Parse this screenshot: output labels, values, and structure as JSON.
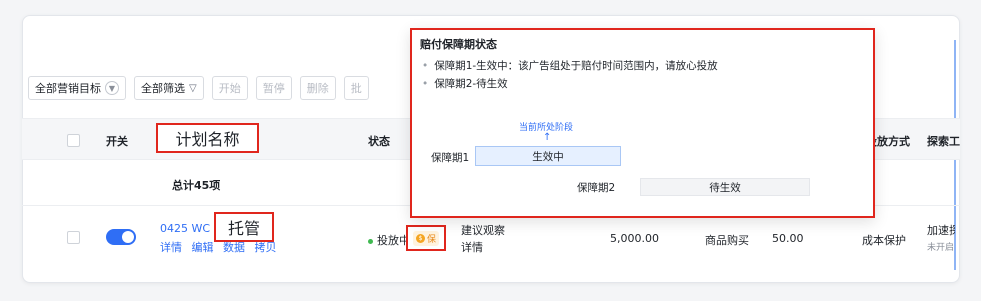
{
  "toolbar": {
    "all_goals": "全部营销目标",
    "all_filter": "全部筛选",
    "start": "开始",
    "pause": "暂停",
    "delete": "删除",
    "more": "批"
  },
  "table": {
    "headers": {
      "switch": "开关",
      "status": "状态",
      "delivery_method": "投放方式",
      "explore": "探索工"
    },
    "total": "总计45项",
    "row": {
      "name": "0425 WC",
      "actions": [
        "详情",
        "编辑",
        "数据",
        "拷贝"
      ],
      "status": "投放中",
      "badge": "保",
      "suggestion": "建议观察",
      "suggestion_link": "详情",
      "budget": "5,000.00",
      "goal": "商品购买",
      "bid": "50.00",
      "method": "成本保护",
      "explore_link": "加速探",
      "explore_sub": "未开启"
    }
  },
  "annotations": {
    "plan_name": "计划名称",
    "managed": "托管"
  },
  "tooltip": {
    "title": "赔付保障期状态",
    "items": [
      "保障期1-生效中：该广告组处于赔付时间范围内，请放心投放",
      "保障期2-待生效"
    ],
    "current_stage_label": "当前所处阶段",
    "period1_label": "保障期1",
    "period1_status": "生效中",
    "period2_label": "保障期2",
    "period2_status": "待生效"
  },
  "colors": {
    "accent": "#2f6ef5",
    "annotation_border": "#e0261d",
    "status_dot": "#3fb950",
    "badge": "#f5a623"
  }
}
